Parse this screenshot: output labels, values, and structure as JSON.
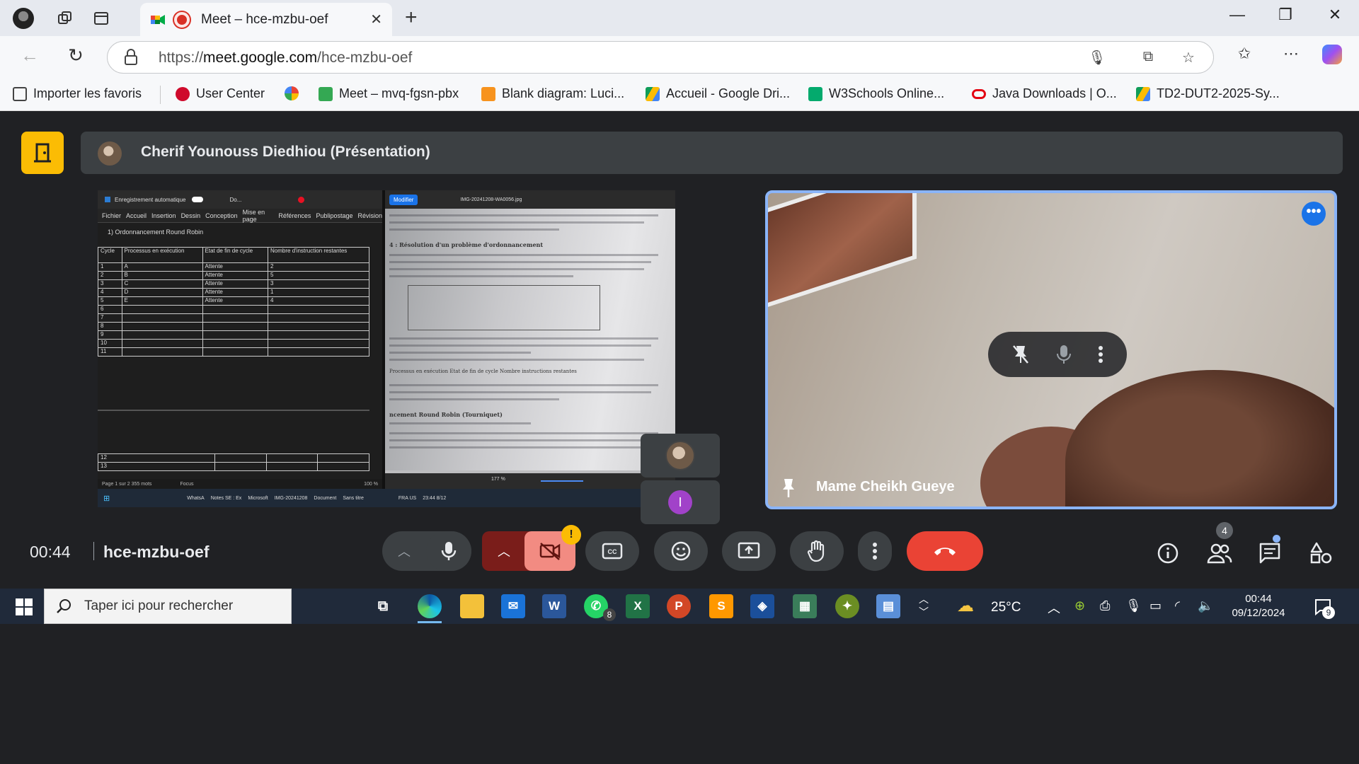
{
  "browser": {
    "tab_title": "Meet – hce-mzbu-oef",
    "url_prefix": "https://",
    "url_host": "meet.google.com",
    "url_path": "/hce-mzbu-oef",
    "bookmarks": [
      {
        "label": "Importer les favoris",
        "color": "#444444"
      },
      {
        "label": "User Center",
        "color": "#cf0a2c"
      },
      {
        "label": "",
        "color": "#4285f4"
      },
      {
        "label": "Meet – mvq-fgsn-pbx",
        "color": "#34a853"
      },
      {
        "label": "Blank diagram: Luci...",
        "color": "#f7931e"
      },
      {
        "label": "Accueil - Google Dri...",
        "color": "#fbbc04"
      },
      {
        "label": "W3Schools Online...",
        "color": "#04aa6d"
      },
      {
        "label": "Java Downloads | O...",
        "color": "#e30613"
      },
      {
        "label": "TD2-DUT2-2025-Sy...",
        "color": "#0f9d58"
      }
    ]
  },
  "meet": {
    "presenter": "Cherif Younouss Diedhiou (Présentation)",
    "participant_name": "Mame Cheikh Gueye",
    "self_letter": "I",
    "clock": "00:44",
    "meeting_code": "hce-mzbu-oef",
    "alert_badge": "!",
    "participant_count": "4",
    "accent_color": "#8ab4f8",
    "end_call_color": "#ea4335"
  },
  "shared": {
    "word_title": "Enregistrement automatique",
    "word_doc_name": "Do...",
    "ribbon": [
      "Fichier",
      "Accueil",
      "Insertion",
      "Dessin",
      "Conception",
      "Mise en page",
      "Références",
      "Publipostage",
      "Révision"
    ],
    "heading": "1)   Ordonnancement Round Robin",
    "table_headers": [
      "Cycle",
      "Processus en exécution",
      "Etat de fin de cycle",
      "Nombre d'instruction restantes"
    ],
    "rows": [
      [
        "1",
        "A",
        "Attente",
        "2"
      ],
      [
        "2",
        "B",
        "Attente",
        "5"
      ],
      [
        "3",
        "C",
        "Attente",
        "3"
      ],
      [
        "4",
        "D",
        "Attente",
        "1"
      ],
      [
        "5",
        "E",
        "Attente",
        "4"
      ],
      [
        "6",
        "",
        "",
        ""
      ],
      [
        "7",
        "",
        "",
        ""
      ],
      [
        "8",
        "",
        "",
        ""
      ],
      [
        "9",
        "",
        "",
        ""
      ],
      [
        "10",
        "",
        "",
        ""
      ],
      [
        "11",
        "",
        "",
        ""
      ]
    ],
    "lower_rows": [
      "12",
      "13"
    ],
    "status_left": "Page 1 sur 2   355 mots",
    "status_focus": "Focus",
    "status_zoom": "100 %",
    "photo_modify": "Modifier",
    "photo_filename": "IMG-20241208-WA0056.jpg",
    "photo_zoom": "177 %",
    "scan_title_1": "4 : Résolution d'un problème d'ordonnancement",
    "scan_title_2": "Processus en exécution   Etat de fin de cycle   Nombre instructions restantes",
    "scan_title_3": "ncement Round Robin (Tourniquet)",
    "mini_taskbar": [
      "WhatsA",
      "Notes SE : Ex",
      "Microsoft",
      "IMG-20241208",
      "Document",
      "Sans titre",
      "FRA US",
      "23:44 8/12"
    ]
  },
  "taskbar": {
    "search_placeholder": "Taper ici pour rechercher",
    "weather": "25°C",
    "time": "00:44",
    "date": "09/12/2024",
    "whatsapp_badge": "8",
    "notif_count": "9"
  }
}
